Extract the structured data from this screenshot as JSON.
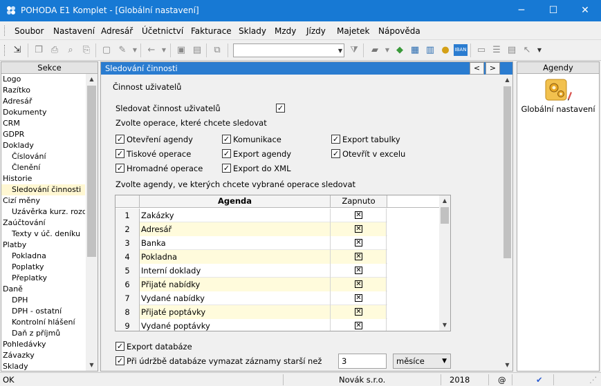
{
  "window": {
    "title": "POHODA E1 Komplet - [Globální nastavení]",
    "controls": {
      "minimize": "─",
      "maximize": "☐",
      "close": "✕"
    }
  },
  "menu": [
    "Soubor",
    "Nastavení",
    "Adresář",
    "Účetnictví",
    "Fakturace",
    "Sklady",
    "Mzdy",
    "Jízdy",
    "Majetek",
    "Nápověda"
  ],
  "toolbar": {
    "combo_value": ""
  },
  "sekce": {
    "header": "Sekce",
    "items": [
      {
        "label": "Logo",
        "level": 1
      },
      {
        "label": "Razítko",
        "level": 1
      },
      {
        "label": "Adresář",
        "level": 1
      },
      {
        "label": "Dokumenty",
        "level": 1
      },
      {
        "label": "CRM",
        "level": 1
      },
      {
        "label": "GDPR",
        "level": 1
      },
      {
        "label": "Doklady",
        "level": 1
      },
      {
        "label": "Číslování",
        "level": 2
      },
      {
        "label": "Členění",
        "level": 2
      },
      {
        "label": "Historie",
        "level": 1
      },
      {
        "label": "Sledování činnosti",
        "level": 2,
        "selected": true
      },
      {
        "label": "Cizí měny",
        "level": 1
      },
      {
        "label": "Uzávěrka kurz. rozdílů",
        "level": 2
      },
      {
        "label": "Zaúčtování",
        "level": 1
      },
      {
        "label": "Texty v úč. deníku",
        "level": 2
      },
      {
        "label": "Platby",
        "level": 1
      },
      {
        "label": "Pokladna",
        "level": 2
      },
      {
        "label": "Poplatky",
        "level": 2
      },
      {
        "label": "Přeplatky",
        "level": 2
      },
      {
        "label": "Daně",
        "level": 1
      },
      {
        "label": "DPH",
        "level": 2
      },
      {
        "label": "DPH - ostatní",
        "level": 2
      },
      {
        "label": "Kontrolní hlášení",
        "level": 2
      },
      {
        "label": "Daň z příjmů",
        "level": 2
      },
      {
        "label": "Pohledávky",
        "level": 1
      },
      {
        "label": "Závazky",
        "level": 1
      },
      {
        "label": "Sklady",
        "level": 1
      }
    ]
  },
  "main": {
    "header": "Sledování činnosti",
    "nav_prev": "<",
    "nav_next": ">",
    "group_title": "Činnost uživatelů",
    "track_label": "Sledovat činnost uživatelů",
    "track_checked": true,
    "ops_heading": "Zvolte operace, které chcete sledovat",
    "operations": [
      {
        "label": "Otevření agendy",
        "checked": true
      },
      {
        "label": "Komunikace",
        "checked": true
      },
      {
        "label": "Export tabulky",
        "checked": true
      },
      {
        "label": "Tiskové operace",
        "checked": true
      },
      {
        "label": "Export agendy",
        "checked": true
      },
      {
        "label": "Otevřít v excelu",
        "checked": true
      },
      {
        "label": "Hromadné operace",
        "checked": true
      },
      {
        "label": "Export do XML",
        "checked": true
      }
    ],
    "agendas_heading": "Zvolte agendy, ve kterých chcete vybrané operace sledovat",
    "grid": {
      "col_agenda": "Agenda",
      "col_enabled": "Zapnuto",
      "rows": [
        {
          "num": "1",
          "agenda": "Zakázky",
          "enabled": true
        },
        {
          "num": "2",
          "agenda": "Adresář",
          "enabled": true
        },
        {
          "num": "3",
          "agenda": "Banka",
          "enabled": true
        },
        {
          "num": "4",
          "agenda": "Pokladna",
          "enabled": true
        },
        {
          "num": "5",
          "agenda": "Interní doklady",
          "enabled": true
        },
        {
          "num": "6",
          "agenda": "Přijaté nabídky",
          "enabled": true
        },
        {
          "num": "7",
          "agenda": "Vydané nabídky",
          "enabled": true
        },
        {
          "num": "8",
          "agenda": "Přijaté poptávky",
          "enabled": true
        },
        {
          "num": "9",
          "agenda": "Vydané poptávky",
          "enabled": true
        }
      ]
    },
    "export_db_label": "Export databáze",
    "export_db_checked": true,
    "maint_label": "Při údržbě databáze vymazat záznamy starší než",
    "maint_checked": true,
    "maint_value": "3",
    "maint_unit": "měsíce"
  },
  "agendy": {
    "header": "Agendy",
    "item_label": "Globální nastavení"
  },
  "status": {
    "left": "OK",
    "company": "Novák s.r.o.",
    "year": "2018",
    "at": "@"
  }
}
